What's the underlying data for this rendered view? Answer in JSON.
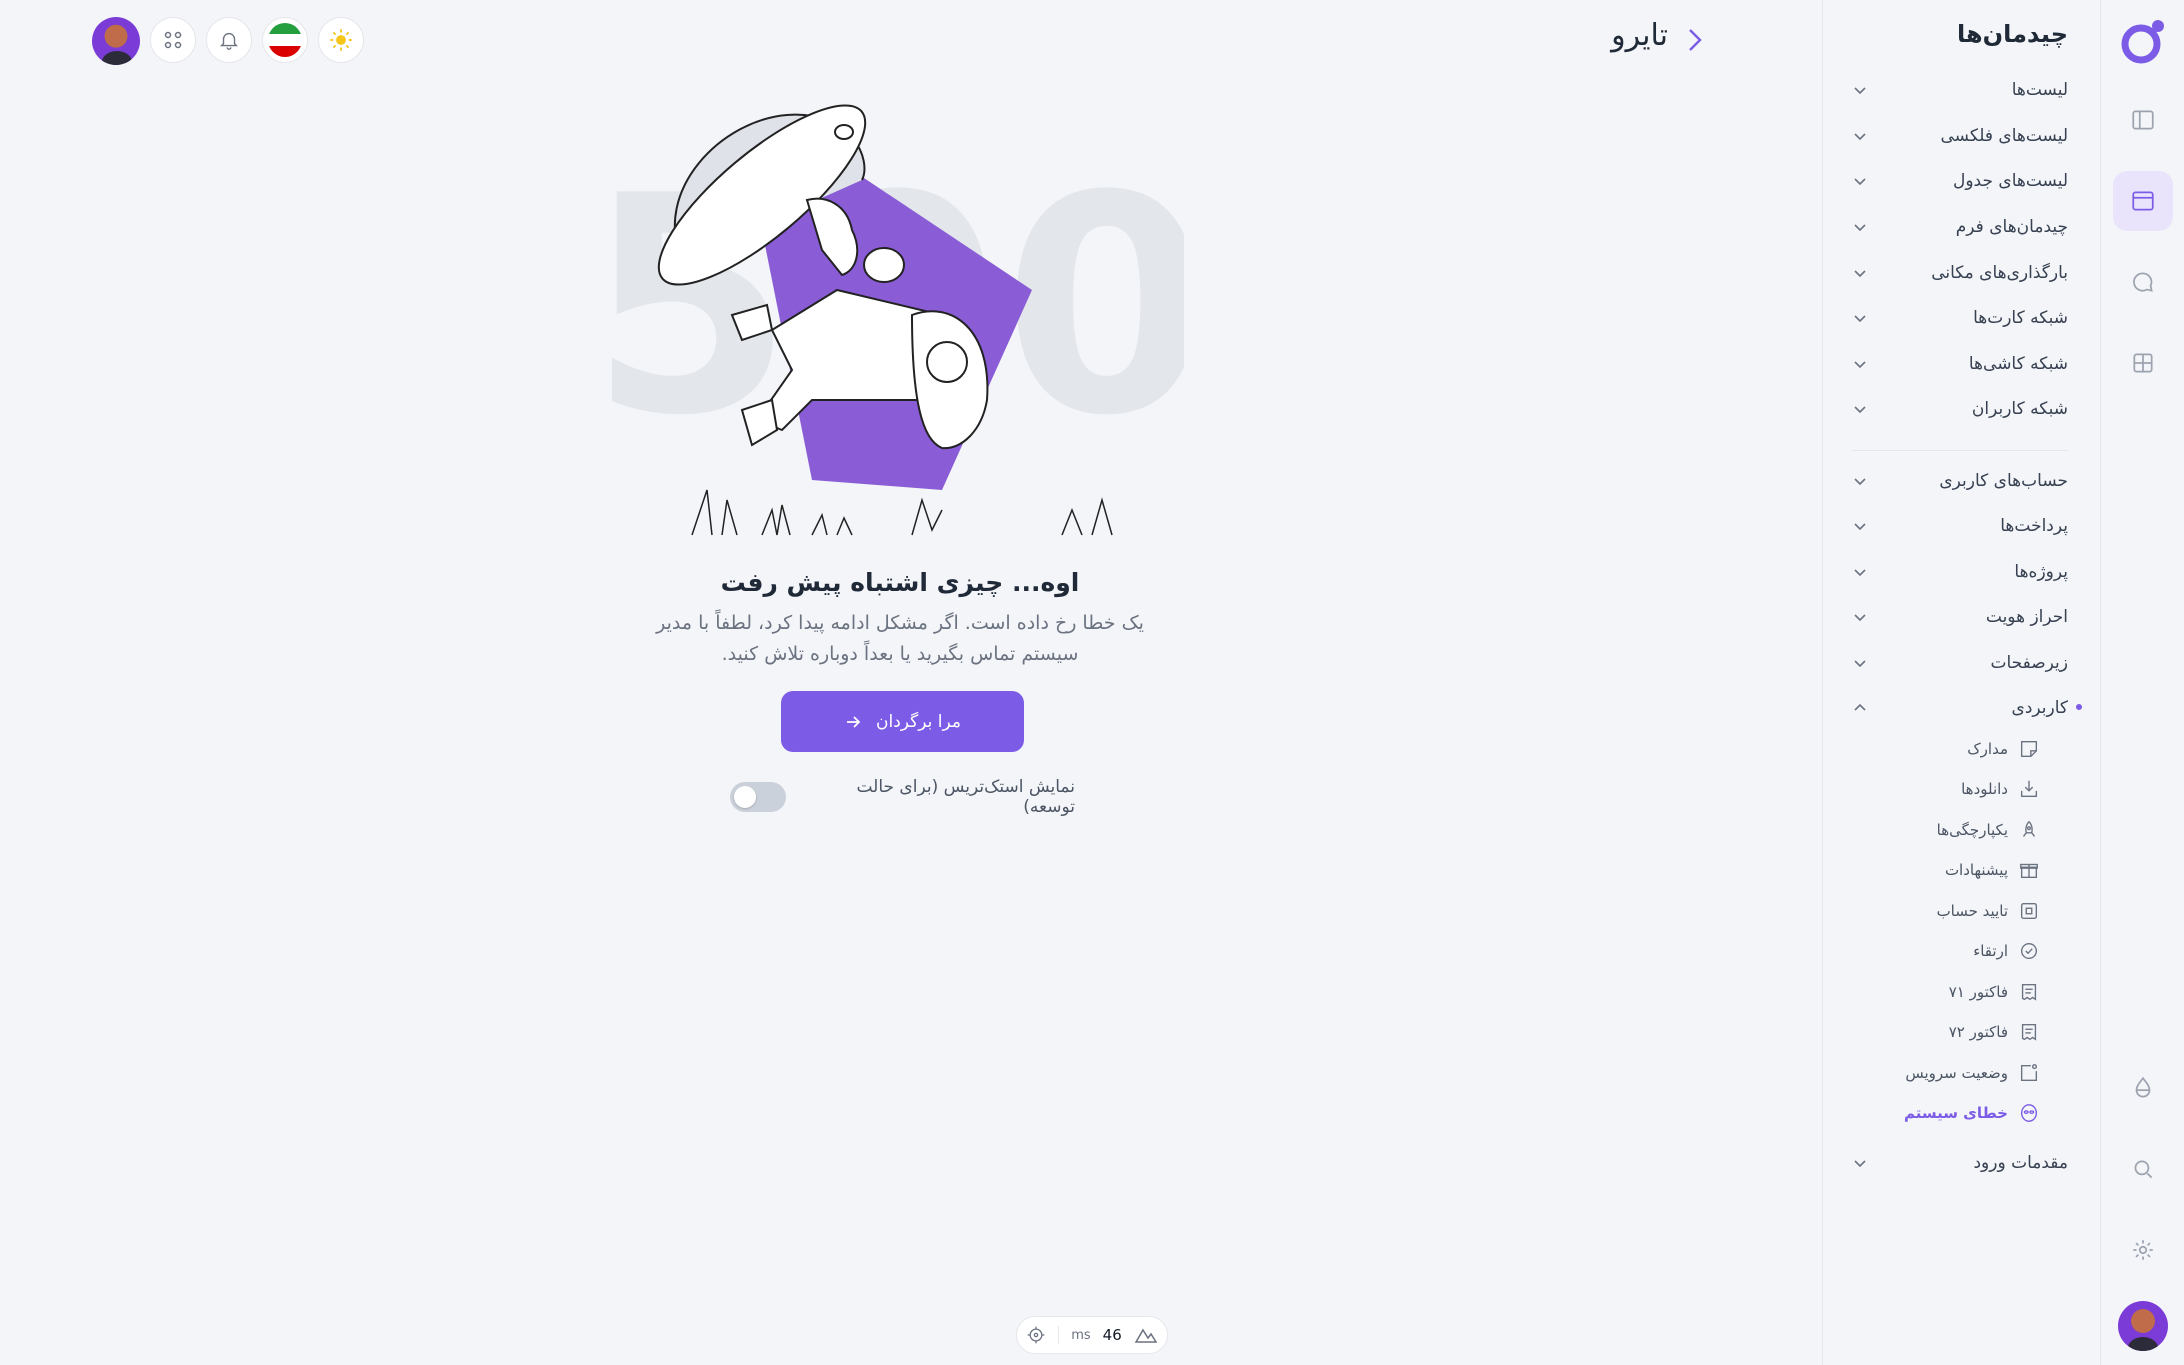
{
  "app": {
    "brand": "تایرو"
  },
  "menu": {
    "title": "چیدمان‌ها",
    "group1": [
      {
        "label": "لیست‌ها"
      },
      {
        "label": "لیست‌های فلکسی"
      },
      {
        "label": "لیست‌های جدول"
      },
      {
        "label": "چیدمان‌های فرم"
      },
      {
        "label": "بارگذاری‌های مکانی"
      },
      {
        "label": "شبکه کارت‌ها"
      },
      {
        "label": "شبکه کاشی‌ها"
      },
      {
        "label": "شبکه کاربران"
      }
    ],
    "group2": [
      {
        "label": "حساب‌های کاربری"
      },
      {
        "label": "پرداخت‌ها"
      },
      {
        "label": "پروژه‌ها"
      },
      {
        "label": "احراز هویت"
      },
      {
        "label": "زیرصفحات"
      },
      {
        "label": "کاربردی"
      }
    ],
    "sub_items": [
      {
        "label": "مدارک",
        "icon": "sticky-note-icon"
      },
      {
        "label": "دانلودها",
        "icon": "download-tray-icon"
      },
      {
        "label": "یکپارچگی‌ها",
        "icon": "rocket-icon"
      },
      {
        "label": "پیشنهادات",
        "icon": "gift-icon"
      },
      {
        "label": "تایید حساب",
        "icon": "square-check-icon"
      },
      {
        "label": "ارتقاء",
        "icon": "badge-check-icon"
      },
      {
        "label": "فاکتور ۷۱",
        "icon": "invoice-icon"
      },
      {
        "label": "فاکتور ۷۲",
        "icon": "invoice-icon"
      },
      {
        "label": "وضعیت سرویس",
        "icon": "status-square-icon"
      },
      {
        "label": "خطای سیستم",
        "icon": "alien-icon",
        "active": true
      }
    ],
    "last": {
      "label": "مقدمات ورود"
    }
  },
  "error": {
    "title": "اوه... چیزی اشتباه پیش رفت",
    "description": "یک خطا رخ داده است. اگر مشکل ادامه پیدا کرد، لطفاً با مدیر سیستم تماس بگیرید یا بعداً دوباره تلاش کنید.",
    "button_label": "مرا برگردان",
    "stack_toggle_label": "نمایش استک‌تریس (برای حالت توسعه)",
    "stack_toggle_on": false,
    "illustration_code": "500"
  },
  "perf": {
    "value": "46",
    "unit": "ms"
  },
  "colors": {
    "accent": "#7c5ce6",
    "background": "#f3f5f9",
    "sun": "#f5c518"
  }
}
